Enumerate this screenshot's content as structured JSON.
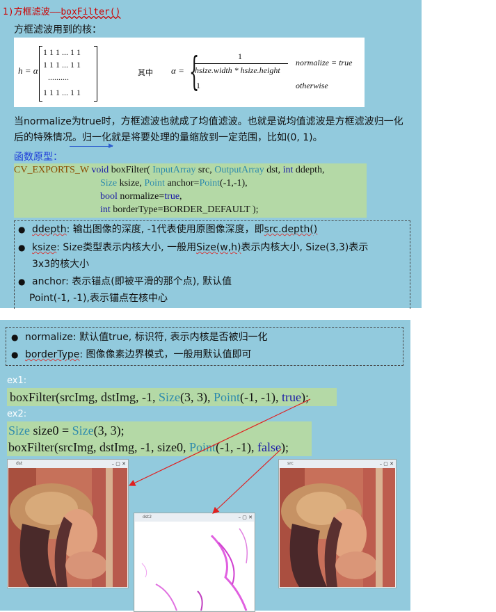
{
  "panel1": {
    "heading_prefix": "1)方框滤波——",
    "heading_fn": "boxFilter()",
    "kernel_intro": "方框滤波用到的核：",
    "formula": {
      "h_eq": "h = α",
      "matrix_rows": [
        "1 1 1 ... 1 1",
        "1 1 1 ... 1 1",
        "..........",
        "1 1 1 ... 1 1"
      ],
      "where": "其中",
      "alpha_eq": "α =",
      "case1_num": "1",
      "case1_den": "hsize.width * hsize.height",
      "case1_cond": "normalize = true",
      "case2_val": "1",
      "case2_cond": "otherwise"
    },
    "para": "当normalize为true时，方框滤波也就成了均值滤波。也就是说均值滤波是方框滤波归一化后的特殊情况。归一化就是将要处理的量缩放到一定范围，比如(0, 1)。",
    "proto_label": "函数原型：",
    "proto": {
      "l1_macro": "CV_EXPORTS_W ",
      "l1_void": "void",
      "l1_fn": " boxFilter( ",
      "l1_t1": "InputArray",
      "l1_p1": " src, ",
      "l1_t2": "OutputArray",
      "l1_p2": " dst, ",
      "l1_int": "int",
      "l1_p3": " ddepth,",
      "l2_t": "Size",
      "l2_p": " ksize, ",
      "l2_t2": "Point",
      "l2_p2": " anchor=",
      "l2_t3": "Point",
      "l2_p3": "(-1,-1),",
      "l3_k": "bool",
      "l3_p": " normalize=",
      "l3_v": "true",
      "l3_e": ",",
      "l4_k": "int",
      "l4_p": " borderType=BORDER_DEFAULT );"
    },
    "b1_name": "ddepth",
    "b1_text": ": 输出图像的深度, -1代表使用原图像深度，即",
    "b1_code": "src.depth()",
    "b2_name": "ksize",
    "b2_text_a": ": Size类型表示内核大小, 一般用",
    "b2_code": "Size(w,h)",
    "b2_text_b": "表示内核大小, Size(3,3)表示",
    "b2_cont": "3x3的核大小",
    "b3_text": "anchor: 表示锚点(即被平滑的那个点), 默认值",
    "b3_cont": "Point(-1, -1),表示锚点在核中心"
  },
  "panel2": {
    "b4_text": "normalize: 默认值true, 标识符, 表示内核是否被归一化",
    "b5_name": "borderType",
    "b5_text": ": 图像像素边界模式，一般用默认值即可",
    "ex1_label": "ex1:",
    "ex1": {
      "a": "boxFilter(srcImg, dstImg, -1, ",
      "size": "Size",
      "b": "(3, 3), ",
      "point": "Point",
      "c": "(-1, -1), ",
      "val": "true",
      "d": ");"
    },
    "ex2_label": "ex2:",
    "ex2": {
      "l1_size": "Size",
      "l1_a": " size0 = ",
      "l1_size2": "Size",
      "l1_b": "(3, 3);",
      "l2_a": "boxFilter(srcImg, dstImg, -1, size0, ",
      "l2_point": "Point",
      "l2_b": "(-1, -1), ",
      "l2_val": "false",
      "l2_c": ");"
    },
    "win1_title": "dst",
    "win2_title": "dst2",
    "win3_title": "src"
  },
  "colors": {
    "panel_bg": "#92cadd",
    "code_bg": "#b4d9a6",
    "type_color": "#2e8bad",
    "keyword_color": "#1a1aa6",
    "heading_color": "#cc0000",
    "arrow_color": "#e02020"
  }
}
